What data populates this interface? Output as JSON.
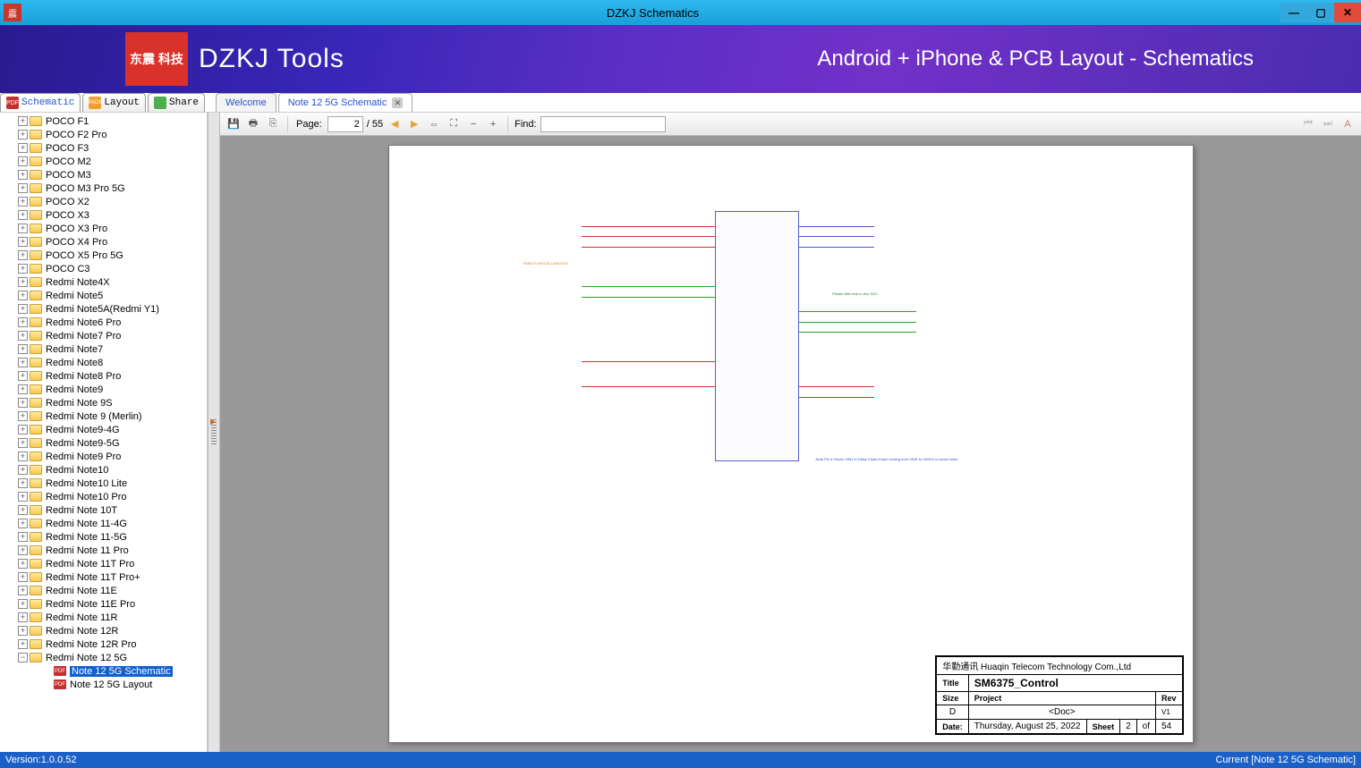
{
  "window": {
    "title": "DZKJ Schematics"
  },
  "banner": {
    "logo_cn": "东震\n科技",
    "logo_text": "DZKJ Tools",
    "right_text": "Android + iPhone & PCB Layout - Schematics"
  },
  "side_tabs": {
    "schematic": "Schematic",
    "layout": "Layout",
    "share": "Share"
  },
  "doc_tabs": {
    "welcome": "Welcome",
    "active": "Note 12 5G Schematic"
  },
  "tree": [
    {
      "label": "POCO F1"
    },
    {
      "label": "POCO F2 Pro"
    },
    {
      "label": "POCO F3"
    },
    {
      "label": "POCO M2"
    },
    {
      "label": "POCO M3"
    },
    {
      "label": "POCO M3 Pro 5G"
    },
    {
      "label": "POCO X2"
    },
    {
      "label": "POCO X3"
    },
    {
      "label": "POCO X3 Pro"
    },
    {
      "label": "POCO X4 Pro"
    },
    {
      "label": "POCO X5 Pro 5G"
    },
    {
      "label": "POCO C3"
    },
    {
      "label": "Redmi Note4X"
    },
    {
      "label": "Redmi Note5"
    },
    {
      "label": "Redmi Note5A(Redmi Y1)"
    },
    {
      "label": "Redmi Note6 Pro"
    },
    {
      "label": "Redmi Note7 Pro"
    },
    {
      "label": "Redmi Note7"
    },
    {
      "label": "Redmi Note8"
    },
    {
      "label": "Redmi Note8 Pro"
    },
    {
      "label": "Redmi Note9"
    },
    {
      "label": "Redmi Note 9S"
    },
    {
      "label": "Redmi Note 9 (Merlin)"
    },
    {
      "label": "Redmi Note9-4G"
    },
    {
      "label": "Redmi Note9-5G"
    },
    {
      "label": "Redmi Note9 Pro"
    },
    {
      "label": "Redmi Note10"
    },
    {
      "label": "Redmi Note10 Lite"
    },
    {
      "label": "Redmi Note10 Pro"
    },
    {
      "label": "Redmi Note 10T"
    },
    {
      "label": "Redmi Note 11-4G"
    },
    {
      "label": "Redmi Note 11-5G"
    },
    {
      "label": "Redmi Note 11 Pro"
    },
    {
      "label": "Redmi Note 11T Pro"
    },
    {
      "label": "Redmi Note 11T Pro+"
    },
    {
      "label": "Redmi Note 11E"
    },
    {
      "label": "Redmi Note 11E Pro"
    },
    {
      "label": "Redmi Note 11R"
    },
    {
      "label": "Redmi Note 12R"
    },
    {
      "label": "Redmi Note 12R Pro"
    },
    {
      "label": "Redmi Note 12 5G",
      "expanded": true,
      "children": [
        {
          "label": "Note 12 5G Schematic",
          "type": "pdf",
          "selected": true
        },
        {
          "label": "Note 12 5G Layout",
          "type": "pdf"
        }
      ]
    }
  ],
  "toolbar": {
    "page_label": "Page:",
    "page_current": "2",
    "page_total": "/ 55",
    "find_label": "Find:",
    "find_value": ""
  },
  "info_box": {
    "company": "华勤通讯 Huaqin Telecom Technology Com.,Ltd",
    "title_label": "Title",
    "title_value": "SM6375_Control",
    "size_label": "Size",
    "size_value": "D",
    "project_label": "Project",
    "project_value": "<Doc>",
    "rev_label": "Rev",
    "rev_value": "V1",
    "date_label": "Date:",
    "date_value": "Thursday, August 25, 2022",
    "sheet_label": "Sheet",
    "sheet_current": "2",
    "sheet_of": "of",
    "sheet_total": "54"
  },
  "status": {
    "version": "Version:1.0.0.52",
    "current": "Current [Note 12 5G Schematic]"
  }
}
